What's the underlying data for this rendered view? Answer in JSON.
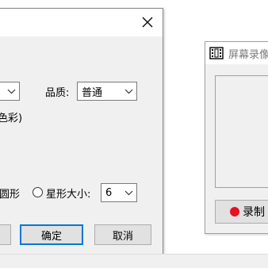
{
  "settings_dialog": {
    "top_combo_value": "",
    "quality_label": "品质:",
    "quality_value": "普通",
    "color_text": "色彩)",
    "circle_label": "圆形",
    "star_size_label": "星形大小:",
    "star_size_value": "6",
    "ok_label": "确定",
    "cancel_label": "取消",
    "close_icon": "close-icon"
  },
  "recorder_window": {
    "title": "屏幕录像",
    "app_icon": "film-icon",
    "record_label": "录制",
    "record_dot_color": "#e81123"
  }
}
